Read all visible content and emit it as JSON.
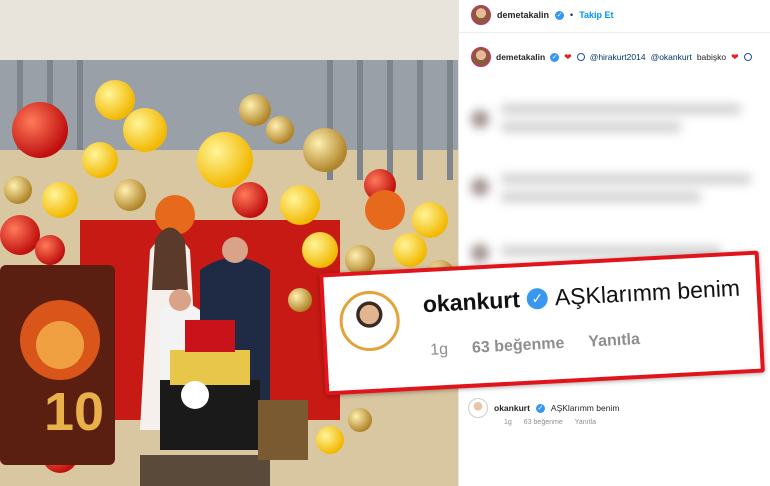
{
  "post_header": {
    "username": "demetakalin",
    "follow_label": "Takip Et"
  },
  "caption": {
    "username": "demetakalin",
    "mention1": "@hirakurt2014",
    "mention2": "@okankurt",
    "text": "babişko"
  },
  "highlight_comment": {
    "username": "okankurt",
    "text": "AŞKlarımm benim",
    "time": "1g",
    "likes": "63 beğenme",
    "reply_label": "Yanıtla"
  },
  "small_comment": {
    "username": "okankurt",
    "text": "AŞKlarımm benim",
    "time": "1g",
    "likes": "63 beğenme",
    "reply_label": "Yanıtla"
  },
  "cake_number": "10",
  "colors": {
    "verified": "#3897f0",
    "callout_border": "#e2141b",
    "follow": "#0095f6"
  },
  "icons": [
    "verified-badge-icon",
    "heart-icon",
    "galatasaray-circle-icon"
  ]
}
